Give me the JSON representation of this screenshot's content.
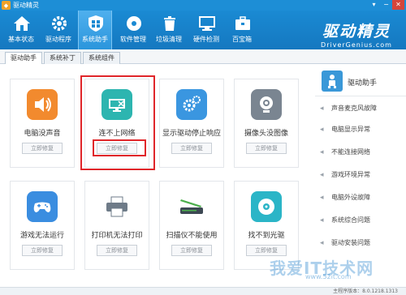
{
  "window": {
    "title": "驱动精灵"
  },
  "toolbar": {
    "items": [
      {
        "label": "基本状态",
        "icon": "home-icon"
      },
      {
        "label": "驱动程序",
        "icon": "gear-icon"
      },
      {
        "label": "系统助手",
        "icon": "shield-icon"
      },
      {
        "label": "软件管理",
        "icon": "disc-icon"
      },
      {
        "label": "垃圾清理",
        "icon": "trash-icon"
      },
      {
        "label": "硬件检测",
        "icon": "monitor-icon"
      },
      {
        "label": "百宝箱",
        "icon": "briefcase-icon"
      }
    ],
    "active_index": 2,
    "brand_cn": "驱动精灵",
    "brand_en": "DriverGenius.com"
  },
  "tabs": [
    {
      "label": "驱动助手"
    },
    {
      "label": "系统补丁"
    },
    {
      "label": "系统组件"
    }
  ],
  "cards": [
    {
      "label": "电脑没声音",
      "button": "立即修复",
      "icon": "speaker-icon",
      "color": "#f28a2e"
    },
    {
      "label": "连不上网络",
      "button": "立即修复",
      "icon": "network-disconnected-icon",
      "color": "#2db5b0"
    },
    {
      "label": "显示驱动停止响应",
      "button": "立即修复",
      "icon": "gears-icon",
      "color": "#3a96e0"
    },
    {
      "label": "摄像头没图像",
      "button": "立即修复",
      "icon": "webcam-icon",
      "color": "#7a8591"
    },
    {
      "label": "游戏无法运行",
      "button": "立即修复",
      "icon": "gamepad-icon",
      "color": "#3a8de0"
    },
    {
      "label": "打印机无法打印",
      "button": "立即修复",
      "icon": "printer-icon",
      "color": "#6e7b88"
    },
    {
      "label": "扫描仪不能使用",
      "button": "立即修复",
      "icon": "scanner-icon",
      "color": "#4cae4c"
    },
    {
      "label": "找不到光驱",
      "button": "立即修复",
      "icon": "cdrom-icon",
      "color": "#2bb5c7"
    }
  ],
  "sidebar": {
    "title": "驱动助手",
    "items": [
      {
        "label": "声音麦克风故障"
      },
      {
        "label": "电脑显示异常"
      },
      {
        "label": "不能连接网络"
      },
      {
        "label": "游戏环境异常"
      },
      {
        "label": "电脑外设故障"
      },
      {
        "label": "系统综合问题"
      },
      {
        "label": "驱动安装问题"
      }
    ]
  },
  "status": {
    "version": "主程序版本：8.0.1218.1313"
  },
  "watermark": {
    "big": "我爱IT技术网",
    "small": "www.52it.com"
  },
  "colors": {
    "toolbar": "#1a8ad3",
    "highlight": "#e0262a"
  }
}
